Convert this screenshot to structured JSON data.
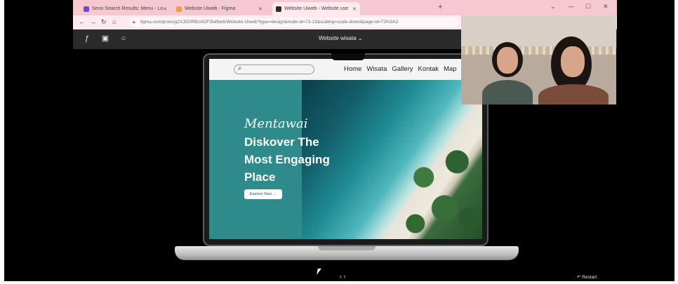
{
  "browser": {
    "tabs": [
      {
        "label": "Seno Search Results: Menu - Lo",
        "fav_color": "#6a4bd6"
      },
      {
        "label": "Website Uiweb - Figma",
        "fav_color": "#f0a046"
      },
      {
        "label": "Website Uiweb - Website use",
        "fav_color": "#2b2b2b"
      }
    ],
    "new_tab": "+",
    "url": "figma.com/proto/g2XJfZ0RBzAGF3lelfbe6/Website-Uiweb?type=design&node-id=73-13&scaling=scale-down&page-id=73%3A2",
    "window_controls": [
      "⌄",
      "—",
      "☐",
      "✕"
    ]
  },
  "figma": {
    "title": "Website wisata ⌄"
  },
  "site": {
    "nav_links": [
      "Home",
      "Wisata",
      "Gallery",
      "Kontak",
      "Map"
    ],
    "script_title": "Mentawai",
    "headline": [
      "Diskover The",
      "Most Engaging",
      "Place"
    ],
    "cta": "Explore Now →",
    "accent": "#2f8b8b"
  },
  "controls": {
    "pager": "‹ ›",
    "restart": "↶ Restart"
  }
}
